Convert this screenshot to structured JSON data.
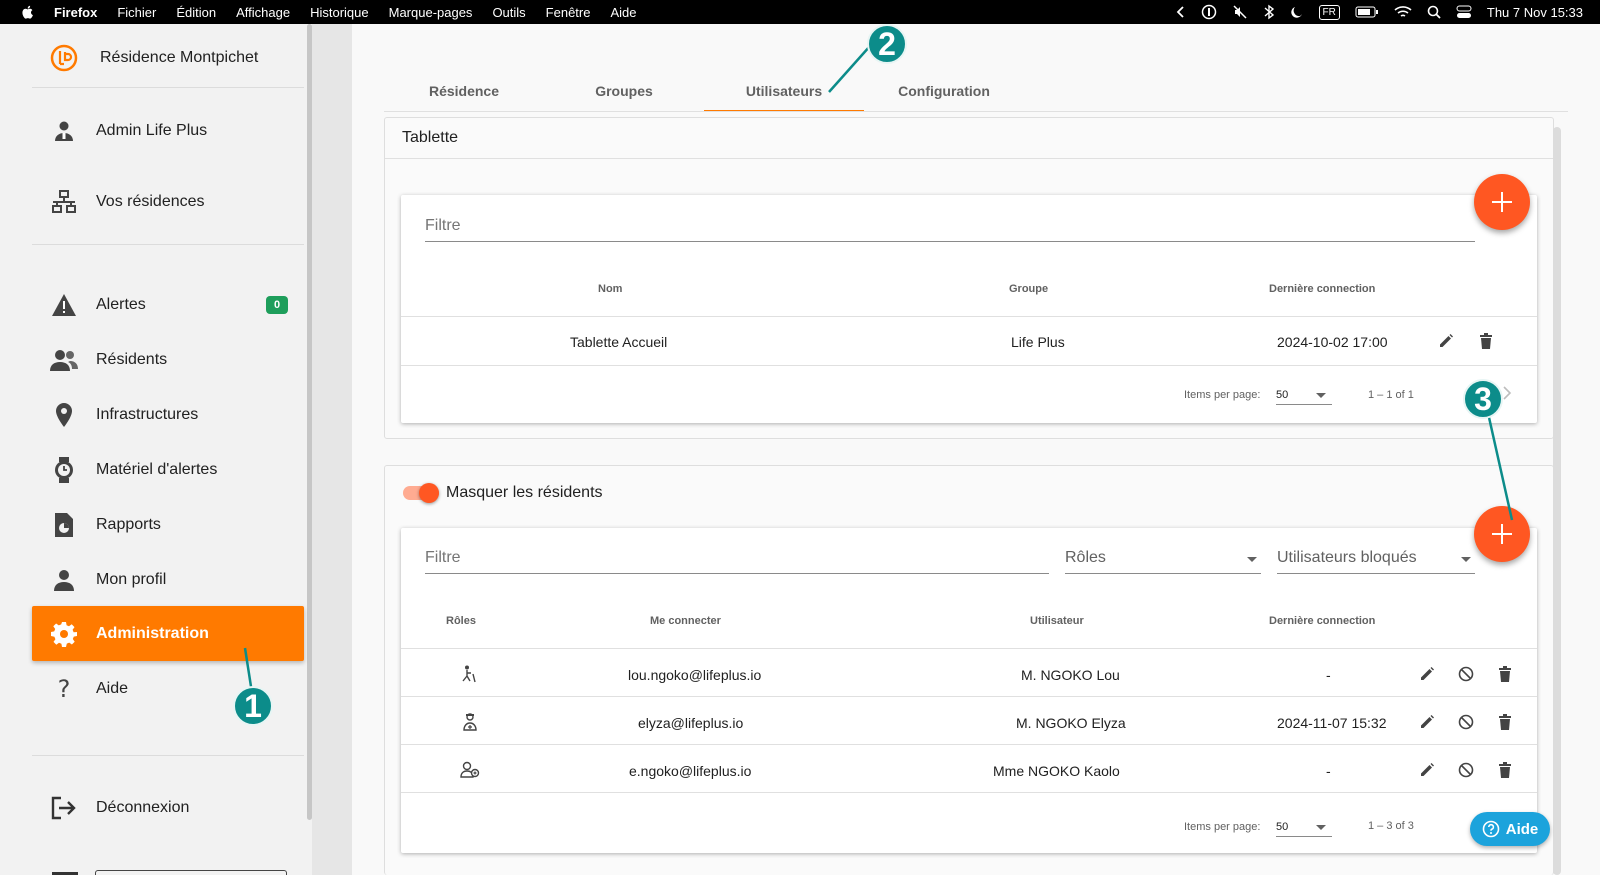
{
  "menubar": {
    "app": "Firefox",
    "items": [
      "Fichier",
      "Édition",
      "Affichage",
      "Historique",
      "Marque-pages",
      "Outils",
      "Fenêtre",
      "Aide"
    ],
    "input_source": "FR",
    "clock": "Thu 7 Nov  15:33"
  },
  "sidebar": {
    "brand": "Résidence Montpichet",
    "items": [
      {
        "label": "Admin Life Plus",
        "icon": "admin-user-icon"
      },
      {
        "label": "Vos résidences",
        "icon": "sitemap-icon"
      },
      {
        "label": "Alertes",
        "icon": "warning-icon",
        "badge": "0"
      },
      {
        "label": "Résidents",
        "icon": "people-icon"
      },
      {
        "label": "Infrastructures",
        "icon": "location-pin-icon"
      },
      {
        "label": "Matériel d'alertes",
        "icon": "watch-icon"
      },
      {
        "label": "Rapports",
        "icon": "report-icon"
      },
      {
        "label": "Mon profil",
        "icon": "person-icon"
      },
      {
        "label": "Administration",
        "icon": "gear-icon",
        "active": true
      },
      {
        "label": "Aide",
        "icon": "question-icon"
      },
      {
        "label": "Déconnexion",
        "icon": "logout-icon"
      }
    ]
  },
  "tabs": [
    "Résidence",
    "Groupes",
    "Utilisateurs",
    "Configuration"
  ],
  "active_tab": "Utilisateurs",
  "tablette": {
    "title": "Tablette",
    "filter_placeholder": "Filtre",
    "columns": [
      "Nom",
      "Groupe",
      "Dernière connection"
    ],
    "rows": [
      {
        "nom": "Tablette Accueil",
        "groupe": "Life Plus",
        "derniere": "2024-10-02 17:00"
      }
    ],
    "pager": {
      "label": "Items per page:",
      "value": "50",
      "range": "1 – 1 of 1"
    }
  },
  "users": {
    "toggle_label": "Masquer les résidents",
    "filter_placeholder": "Filtre",
    "roles_placeholder": "Rôles",
    "blocked_placeholder": "Utilisateurs bloqués",
    "columns": [
      "Rôles",
      "Me connecter",
      "Utilisateur",
      "Dernière connection"
    ],
    "rows": [
      {
        "role_icon": "elderly-icon",
        "login": "lou.ngoko@lifeplus.io",
        "user": "M. NGOKO Lou",
        "derniere": "-"
      },
      {
        "role_icon": "caregiver-icon",
        "login": "elyza@lifeplus.io",
        "user": "M. NGOKO Elyza",
        "derniere": "2024-11-07 15:32"
      },
      {
        "role_icon": "family-icon",
        "login": "e.ngoko@lifeplus.io",
        "user": "Mme NGOKO Kaolo",
        "derniere": "-"
      }
    ],
    "pager": {
      "label": "Items per page:",
      "value": "50",
      "range": "1 – 3 of 3"
    }
  },
  "help_button": "Aide",
  "callouts": [
    "1",
    "2",
    "3"
  ],
  "colors": {
    "accent": "#ff7a00",
    "fab": "#ff5722",
    "callout": "#0c8c8a",
    "badge": "#1e9e5b",
    "help": "#1ca3dc"
  }
}
